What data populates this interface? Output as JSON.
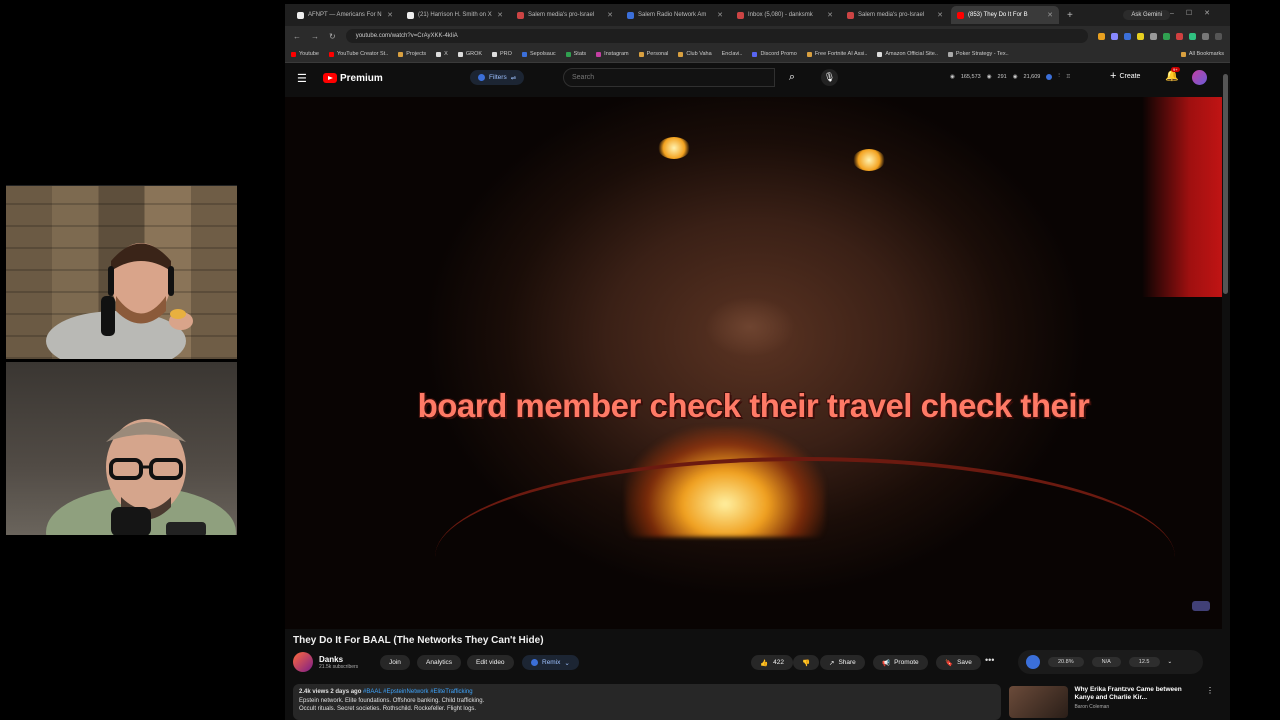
{
  "browser": {
    "tabs": [
      {
        "title": "AFNPT — Americans For N",
        "color": "#eee"
      },
      {
        "title": "(21) Harrison H. Smith on X",
        "color": "#eee"
      },
      {
        "title": "Salem media's pro-Israel",
        "color": "#c44"
      },
      {
        "title": "Salem Radio Network Am",
        "color": "#3b6fd9"
      },
      {
        "title": "Inbox (5,080) - danksmk",
        "color": "#c44"
      },
      {
        "title": "Salem media's pro-Israel",
        "color": "#c44"
      },
      {
        "title": "(853) They Do It For B",
        "color": "#f00",
        "active": true
      }
    ],
    "ask_gemini": "Ask Gemini",
    "url": "youtube.com/watch?v=CrAyXKK-4kIiA",
    "bookmarks": [
      "Youtube",
      "YouTube Creator St..",
      "Projects",
      "X",
      "GROK",
      "PRO",
      "Sepolsauc",
      "Stats",
      "Instagram",
      "Personal",
      "Club Vaha",
      "Enclavi..",
      "Discord Promo",
      "Free Fortnite AI Assi..",
      "Amazon Official Site..",
      "Poker Strategy - Tex.."
    ],
    "all_bookmarks": "All Bookmarks"
  },
  "youtube": {
    "logo": "Premium",
    "filters": "Filters",
    "search_placeholder": "Search",
    "header_stats": [
      "165,573",
      "291",
      "21,609"
    ],
    "create": "Create",
    "notif_badge": "9+"
  },
  "video": {
    "caption": "board member check their travel check their",
    "title": "They Do It For BAAL (The Networks They Can't Hide)",
    "channel": "Danks",
    "subscribers": "21.5k subscribers",
    "buttons": {
      "join": "Join",
      "analytics": "Analytics",
      "edit": "Edit video",
      "remix": "Remix",
      "likes": "422",
      "share": "Share",
      "promote": "Promote",
      "save": "Save"
    },
    "description": {
      "meta": "2.4k views  2 days ago",
      "tags": "#BAAL #EpsteinNetwork #EliteTrafficking",
      "line1": "Epstein network. Elite foundations. Offshore banking. Child trafficking.",
      "line2": "Occult rituals. Secret societies. Rothschild. Rockefeller. Flight logs."
    }
  },
  "sidebar": {
    "stats": [
      "20.8%",
      "N/A",
      "12.5"
    ],
    "rec_title": "Why Erika Frantzve Came between Kanye and Charlie Kir...",
    "rec_channel": "Baron Coleman"
  }
}
